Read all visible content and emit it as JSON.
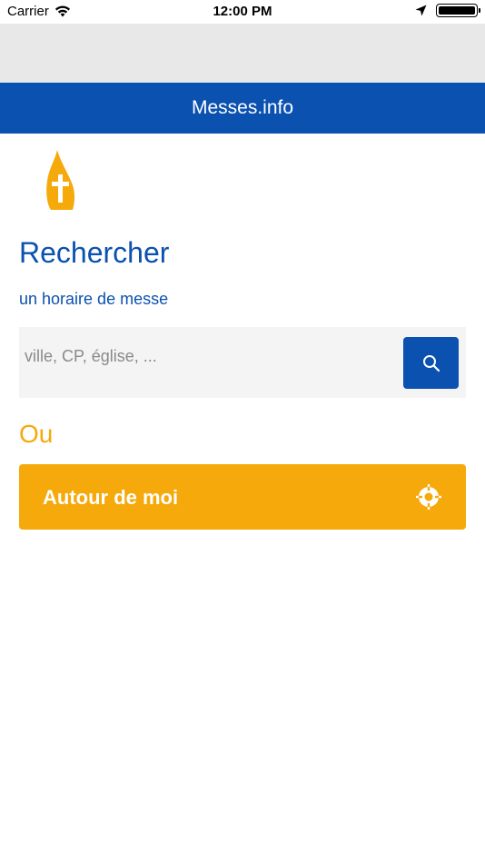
{
  "status_bar": {
    "carrier": "Carrier",
    "time": "12:00 PM",
    "icons": [
      "wifi-icon",
      "location-arrow-icon",
      "battery-icon"
    ],
    "battery_level": 1.0
  },
  "nav": {
    "title": "Messes.info"
  },
  "logo": {
    "icon": "candle-cross-logo"
  },
  "main": {
    "heading": "Rechercher",
    "subheading": "un horaire de messe",
    "search": {
      "placeholder": "ville, CP, église, ...",
      "value": "",
      "button_icon": "search-icon"
    },
    "or_label": "Ou",
    "around_button": {
      "label": "Autour de moi",
      "icon": "crosshair-icon"
    }
  },
  "colors": {
    "primary_blue": "#0b51b0",
    "accent_orange": "#f5a90a",
    "grey_band": "#e8e8e8",
    "search_bg": "#f4f4f4"
  }
}
